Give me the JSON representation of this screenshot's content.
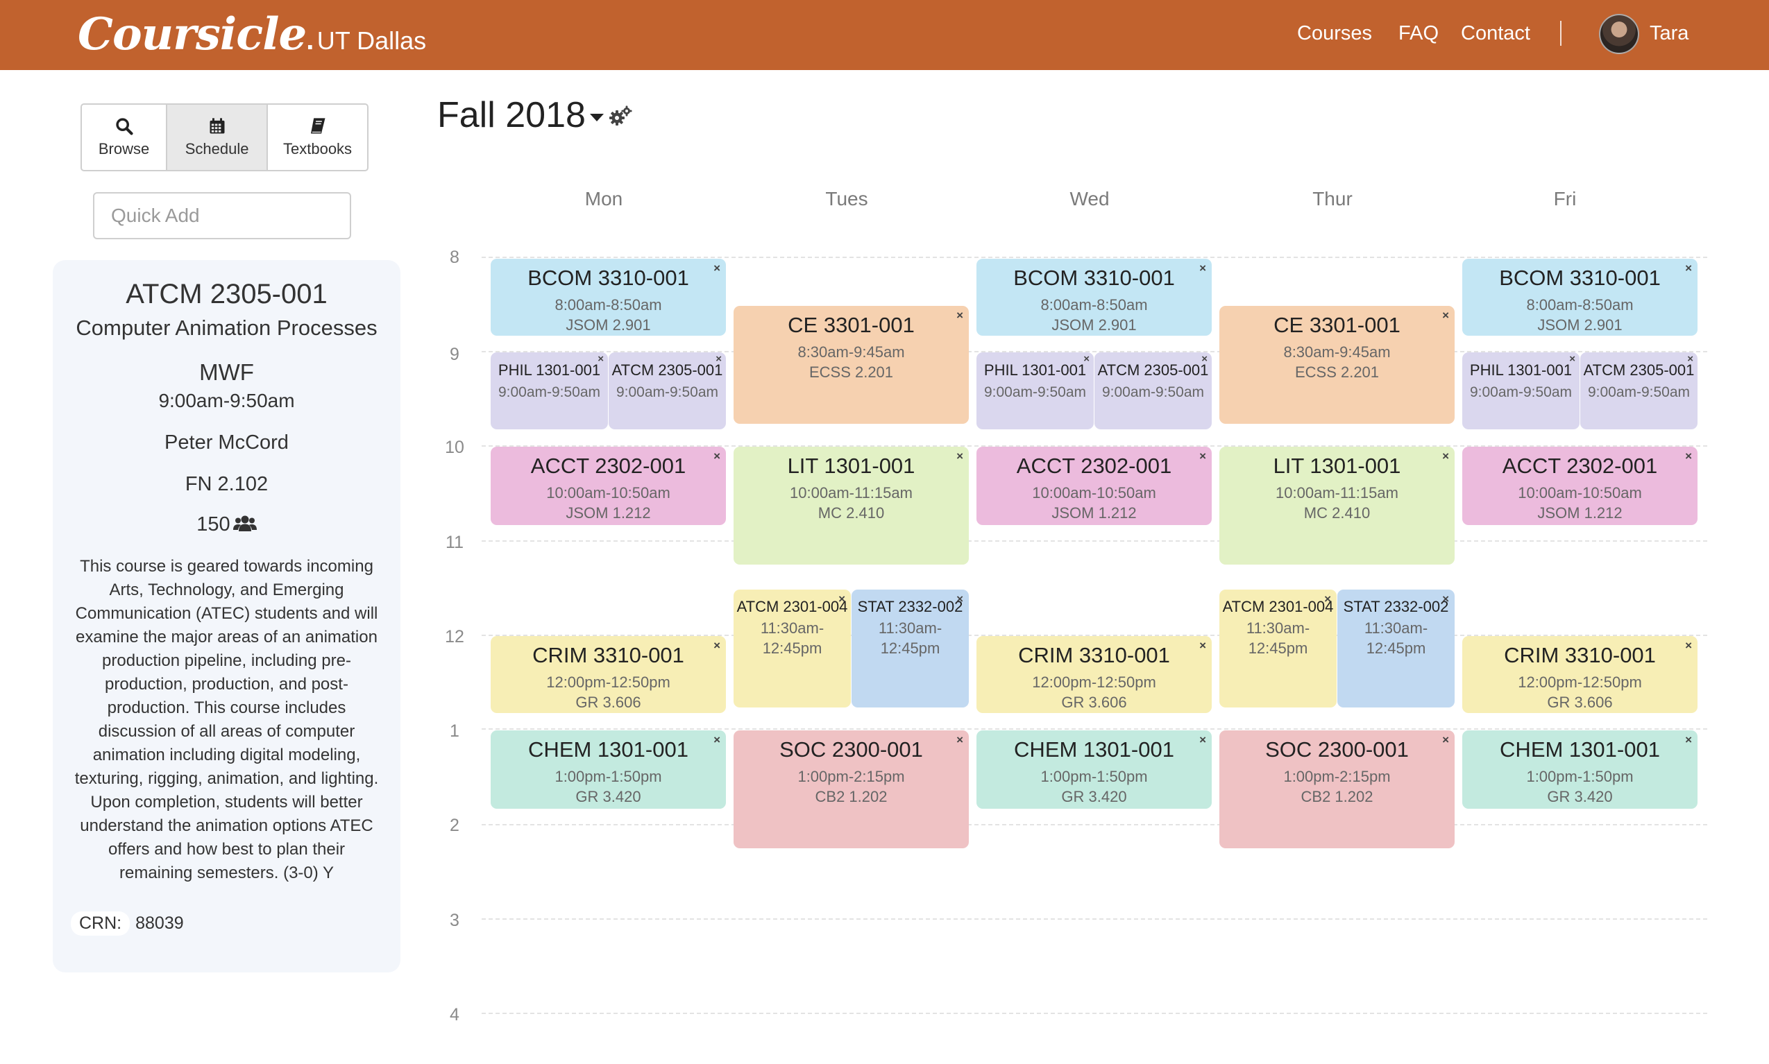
{
  "nav": {
    "brand": "Coursicle",
    "brand_dot": ".",
    "school": "UT Dallas",
    "links": [
      "Courses",
      "FAQ",
      "Contact"
    ],
    "user_name": "Tara"
  },
  "sidebar": {
    "modes": [
      "Browse",
      "Schedule",
      "Textbooks"
    ],
    "active_mode": "Schedule",
    "quick_add_placeholder": "Quick Add"
  },
  "course_detail": {
    "code": "ATCM 2305-001",
    "title": "Computer Animation Processes",
    "days": "MWF",
    "time": "9:00am-9:50am",
    "instructor": "Peter McCord",
    "room": "FN 2.102",
    "seats": "150",
    "description": "This course is geared towards incoming Arts, Technology, and Emerging Communication (ATEC) students and will examine the major areas of an animation production pipeline, including pre-production, production, and post-production. This course includes discussion of all areas of computer animation including digital modeling, texturing, rigging, animation, and lighting. Upon completion, students will better understand the animation options ATEC offers and how best to plan their remaining semesters. (3-0) Y",
    "crn_label": "CRN:",
    "crn": "88039"
  },
  "calendar": {
    "semester": "Fall 2018",
    "days": [
      "Mon",
      "Tues",
      "Wed",
      "Thur",
      "Fri"
    ],
    "hours": [
      "8",
      "9",
      "10",
      "11",
      "12",
      "1",
      "2",
      "3",
      "4"
    ],
    "close_glyph": "×",
    "colors": {
      "blue": "#c3e6f4",
      "orange": "#f6d1b0",
      "lavender": "#dad7ee",
      "pink": "#ecbbdd",
      "lime": "#e2f1c5",
      "yellow": "#f7eeb5",
      "skyblue": "#c1d9f1",
      "mint": "#c3eadf",
      "rose": "#efc2c4"
    },
    "events": {
      "mon_bcom": {
        "code": "BCOM 3310-001",
        "time": "8:00am-8:50am",
        "room": "JSOM 2.901"
      },
      "mon_phil": {
        "code": "PHIL 1301-001",
        "time": "9:00am-9:50am"
      },
      "mon_atcm2305": {
        "code": "ATCM 2305-001",
        "time": "9:00am-9:50am"
      },
      "mon_acct": {
        "code": "ACCT 2302-001",
        "time": "10:00am-10:50am",
        "room": "JSOM 1.212"
      },
      "mon_crim": {
        "code": "CRIM 3310-001",
        "time": "12:00pm-12:50pm",
        "room": "GR 3.606"
      },
      "mon_chem": {
        "code": "CHEM 1301-001",
        "time": "1:00pm-1:50pm",
        "room": "GR 3.420"
      },
      "tue_ce": {
        "code": "CE 3301-001",
        "time": "8:30am-9:45am",
        "room": "ECSS 2.201"
      },
      "tue_lit": {
        "code": "LIT 1301-001",
        "time": "10:00am-11:15am",
        "room": "MC 2.410"
      },
      "tue_atcm2301": {
        "code": "ATCM 2301-004",
        "time": "11:30am-12:45pm"
      },
      "tue_stat": {
        "code": "STAT 2332-002",
        "time": "11:30am-12:45pm"
      },
      "tue_soc": {
        "code": "SOC 2300-001",
        "time": "1:00pm-2:15pm",
        "room": "CB2 1.202"
      },
      "wed_bcom": {
        "code": "BCOM 3310-001",
        "time": "8:00am-8:50am",
        "room": "JSOM 2.901"
      },
      "wed_phil": {
        "code": "PHIL 1301-001",
        "time": "9:00am-9:50am"
      },
      "wed_atcm2305": {
        "code": "ATCM 2305-001",
        "time": "9:00am-9:50am"
      },
      "wed_acct": {
        "code": "ACCT 2302-001",
        "time": "10:00am-10:50am",
        "room": "JSOM 1.212"
      },
      "wed_crim": {
        "code": "CRIM 3310-001",
        "time": "12:00pm-12:50pm",
        "room": "GR 3.606"
      },
      "wed_chem": {
        "code": "CHEM 1301-001",
        "time": "1:00pm-1:50pm",
        "room": "GR 3.420"
      },
      "thu_ce": {
        "code": "CE 3301-001",
        "time": "8:30am-9:45am",
        "room": "ECSS 2.201"
      },
      "thu_lit": {
        "code": "LIT 1301-001",
        "time": "10:00am-11:15am",
        "room": "MC 2.410"
      },
      "thu_atcm2301": {
        "code": "ATCM 2301-004",
        "time": "11:30am-12:45pm"
      },
      "thu_stat": {
        "code": "STAT 2332-002",
        "time": "11:30am-12:45pm"
      },
      "thu_soc": {
        "code": "SOC 2300-001",
        "time": "1:00pm-2:15pm",
        "room": "CB2 1.202"
      },
      "fri_bcom": {
        "code": "BCOM 3310-001",
        "time": "8:00am-8:50am",
        "room": "JSOM 2.901"
      },
      "fri_phil": {
        "code": "PHIL 1301-001",
        "time": "9:00am-9:50am"
      },
      "fri_atcm2305": {
        "code": "ATCM 2305-001",
        "time": "9:00am-9:50am"
      },
      "fri_acct": {
        "code": "ACCT 2302-001",
        "time": "10:00am-10:50am",
        "room": "JSOM 1.212"
      },
      "fri_crim": {
        "code": "CRIM 3310-001",
        "time": "12:00pm-12:50pm",
        "room": "GR 3.606"
      },
      "fri_chem": {
        "code": "CHEM 1301-001",
        "time": "1:00pm-1:50pm",
        "room": "GR 3.420"
      }
    }
  }
}
